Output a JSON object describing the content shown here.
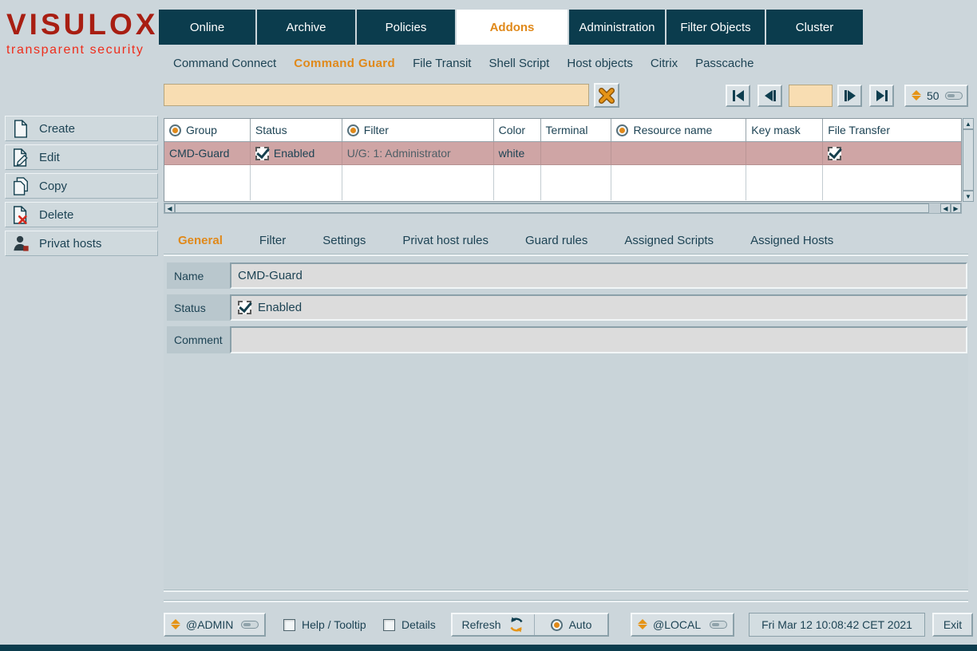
{
  "logo": {
    "title": "VISULOX",
    "subtitle": "transparent security"
  },
  "nav": {
    "tabs": [
      {
        "label": "Online",
        "active": false
      },
      {
        "label": "Archive",
        "active": false
      },
      {
        "label": "Policies",
        "active": false
      },
      {
        "label": "Addons",
        "active": true
      },
      {
        "label": "Administration",
        "active": false
      },
      {
        "label": "Filter Objects",
        "active": false
      },
      {
        "label": "Cluster",
        "active": false
      }
    ]
  },
  "subnav": {
    "items": [
      {
        "label": "Command Connect",
        "active": false
      },
      {
        "label": "Command Guard",
        "active": true
      },
      {
        "label": "File Transit",
        "active": false
      },
      {
        "label": "Shell Script",
        "active": false
      },
      {
        "label": "Host objects",
        "active": false
      },
      {
        "label": "Citrix",
        "active": false
      },
      {
        "label": "Passcache",
        "active": false
      }
    ]
  },
  "toolbar": {
    "search_value": "",
    "page_value": "",
    "page_size": "50",
    "icons": {
      "clear": "orange-x-cross",
      "first": "skip-to-start",
      "prev": "step-back",
      "next": "step-forward",
      "last": "skip-to-end",
      "combo": "orange-double-triangle"
    }
  },
  "table": {
    "columns": [
      {
        "label": "Group",
        "has_radio": true
      },
      {
        "label": "Status",
        "has_radio": false
      },
      {
        "label": "Filter",
        "has_radio": true
      },
      {
        "label": "Color",
        "has_radio": false
      },
      {
        "label": "Terminal",
        "has_radio": false
      },
      {
        "label": "Resource name",
        "has_radio": true
      },
      {
        "label": "Key mask",
        "has_radio": false
      },
      {
        "label": "File Transfer",
        "has_radio": false
      }
    ],
    "row": {
      "group": "CMD-Guard",
      "status": "Enabled",
      "status_checked": true,
      "filter": "U/G: 1: Administrator",
      "color": "white",
      "terminal": "",
      "resource_name": "",
      "key_mask": "",
      "file_transfer_checked": true
    }
  },
  "detail_tabs": [
    {
      "label": "General",
      "active": true
    },
    {
      "label": "Filter",
      "active": false
    },
    {
      "label": "Settings",
      "active": false
    },
    {
      "label": "Privat host rules",
      "active": false
    },
    {
      "label": "Guard rules",
      "active": false
    },
    {
      "label": "Assigned Scripts",
      "active": false
    },
    {
      "label": "Assigned Hosts",
      "active": false
    }
  ],
  "form": {
    "name_label": "Name",
    "name_value": "CMD-Guard",
    "status_label": "Status",
    "status_value": "Enabled",
    "status_checked": true,
    "comment_label": "Comment",
    "comment_value": ""
  },
  "sidebar": {
    "items": [
      {
        "label": "Create",
        "icon": "document-new-icon"
      },
      {
        "label": "Edit",
        "icon": "document-edit-icon"
      },
      {
        "label": "Copy",
        "icon": "document-copy-icon"
      },
      {
        "label": "Delete",
        "icon": "document-delete-icon"
      },
      {
        "label": "Privat hosts",
        "icon": "user-icon"
      }
    ]
  },
  "statusbar": {
    "admin_scope": "@ADMIN",
    "help_label": "Help / Tooltip",
    "help_checked": false,
    "details_label": "Details",
    "details_checked": false,
    "refresh_label": "Refresh",
    "auto_label": "Auto",
    "auto_selected": true,
    "local_scope": "@LOCAL",
    "datetime": "Fri Mar 12 10:08:42 CET 2021",
    "exit_label": "Exit"
  },
  "colors": {
    "accent_orange": "#e0891a",
    "nav_navy": "#0b3c4d",
    "row_highlight": "#cfa5a5",
    "field_tan": "#f8ddb2",
    "logo_red": "#a81e12",
    "logo_sub_red": "#ee2d1b"
  }
}
